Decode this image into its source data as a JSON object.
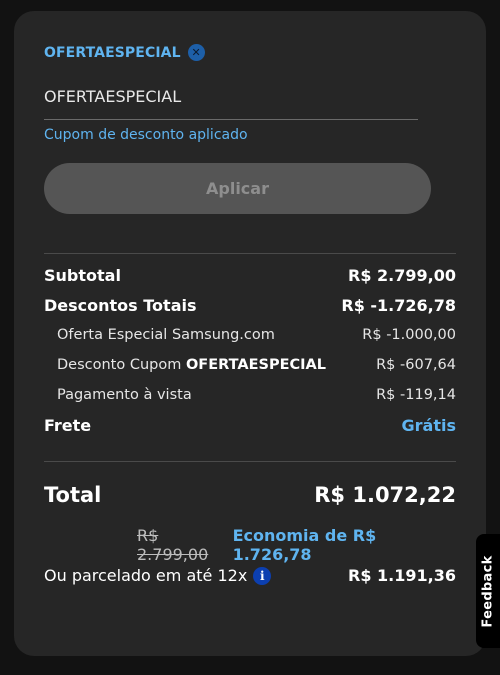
{
  "coupon": {
    "code": "OFERTAESPECIAL",
    "remove_icon": "close-icon",
    "input_value": "OFERTAESPECIAL",
    "status": "Cupom de desconto aplicado",
    "apply_label": "Aplicar"
  },
  "summary": {
    "subtotal_label": "Subtotal",
    "subtotal_value": "R$ 2.799,00",
    "discounts_label": "Descontos Totais",
    "discounts_value": "R$ -1.726,78",
    "items": [
      {
        "label": "Oferta Especial Samsung.com",
        "value": "R$ -1.000,00"
      },
      {
        "label_prefix": "Desconto Cupom ",
        "label_strong": "OFERTAESPECIAL",
        "value": "R$ -607,64"
      },
      {
        "label": "Pagamento à vista",
        "value": "R$ -119,14"
      }
    ],
    "shipping_label": "Frete",
    "shipping_value": "Grátis"
  },
  "total": {
    "label": "Total",
    "value": "R$ 1.072,22",
    "old_price": "R$ 2.799,00",
    "savings": "Economia de R$ 1.726,78",
    "installments_label": "Ou parcelado em até 12x",
    "installments_icon": "info-icon",
    "installments_value": "R$ 1.191,36"
  },
  "feedback": {
    "label": "Feedback"
  },
  "colors": {
    "accent": "#5fb4f0",
    "card_bg": "#262626",
    "page_bg": "#121212",
    "button_disabled": "#555555",
    "info_badge": "#0c3fb0"
  }
}
